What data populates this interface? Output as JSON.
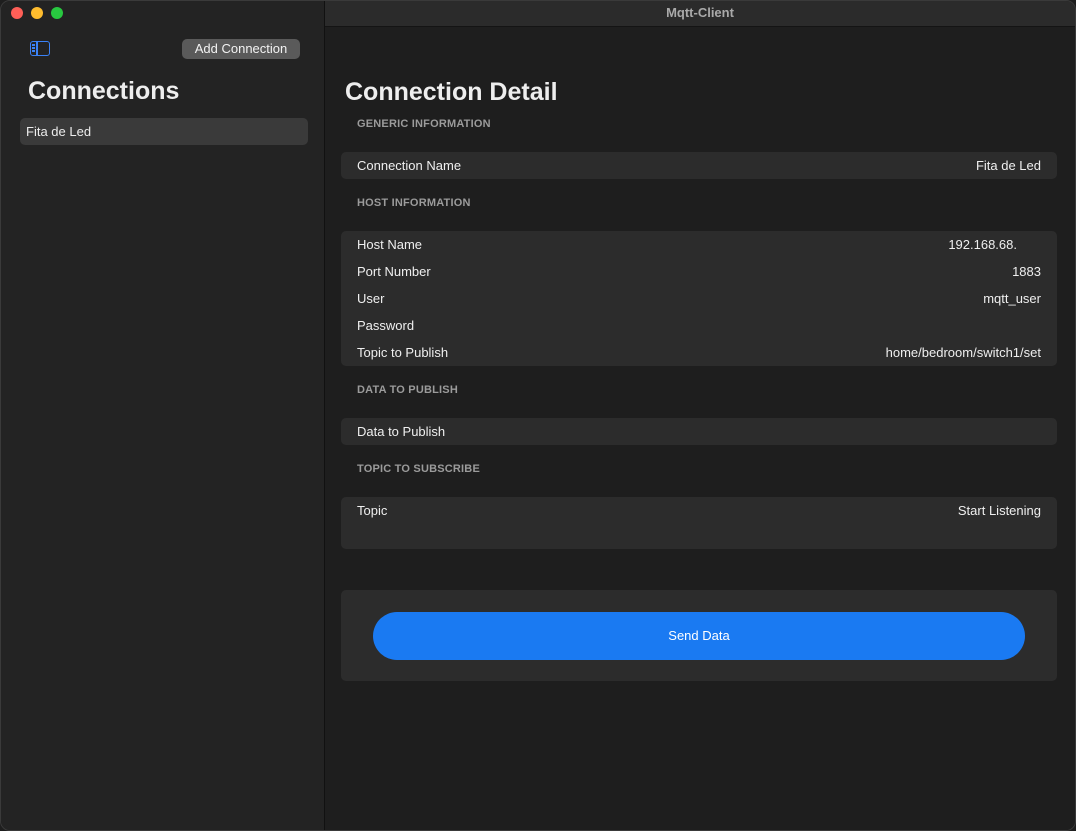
{
  "window": {
    "title": "Mqtt-Client"
  },
  "sidebar": {
    "add_connection_label": "Add Connection",
    "title": "Connections",
    "items": [
      {
        "label": "Fita de Led"
      }
    ]
  },
  "detail": {
    "title": "Connection Detail",
    "generic": {
      "header": "GENERIC INFORMATION",
      "connection_name_label": "Connection Name",
      "connection_name_value": "Fita de Led"
    },
    "host": {
      "header": "HOST INFORMATION",
      "rows": [
        {
          "label": "Host Name",
          "value": "192.168.68."
        },
        {
          "label": "Port Number",
          "value": "1883"
        },
        {
          "label": "User",
          "value": "mqtt_user"
        },
        {
          "label": "Password",
          "value": ""
        },
        {
          "label": "Topic to Publish",
          "value": "home/bedroom/switch1/set"
        }
      ]
    },
    "publish": {
      "header": "DATA TO PUBLISH",
      "placeholder": "Data to Publish",
      "value": ""
    },
    "subscribe": {
      "header": "TOPIC TO SUBSCRIBE",
      "placeholder": "Topic",
      "value": "",
      "start_listening_label": "Start Listening"
    },
    "send_button_label": "Send Data"
  },
  "colors": {
    "accent": "#1a7af2",
    "link": "#3b8ef3",
    "close": "#fe5f57",
    "minimize": "#febc2e",
    "maximize": "#28c840"
  }
}
